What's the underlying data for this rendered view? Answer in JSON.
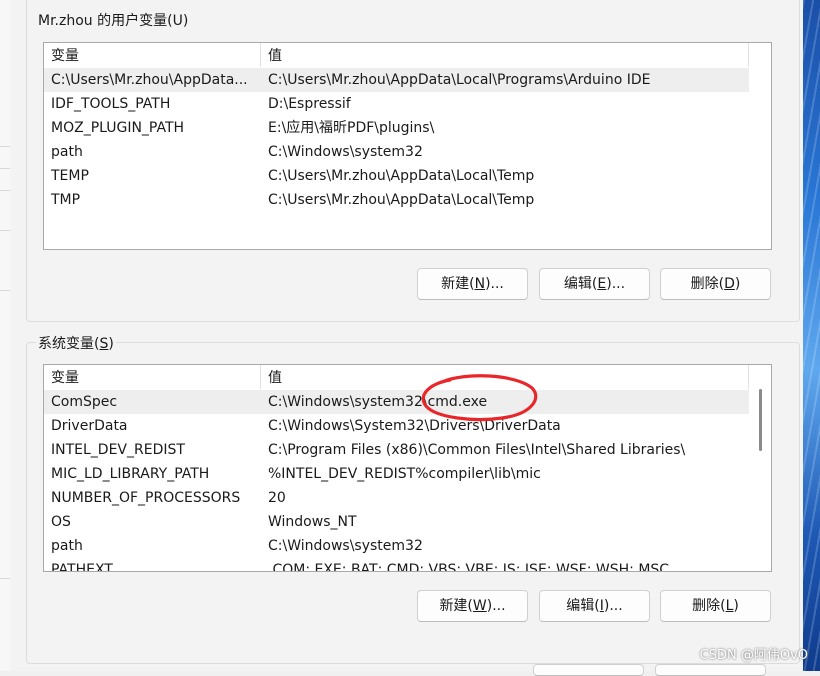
{
  "user_vars": {
    "title": "Mr.zhou 的用户变量(U)",
    "col_name": "变量",
    "col_value": "值",
    "rows": [
      {
        "name": "C:\\Users\\Mr.zhou\\AppData...",
        "value": "C:\\Users\\Mr.zhou\\AppData\\Local\\Programs\\Arduino IDE"
      },
      {
        "name": "IDF_TOOLS_PATH",
        "value": "D:\\Espressif"
      },
      {
        "name": "MOZ_PLUGIN_PATH",
        "value": "E:\\应用\\福昕PDF\\plugins\\"
      },
      {
        "name": "path",
        "value": "C:\\Windows\\system32"
      },
      {
        "name": "TEMP",
        "value": "C:\\Users\\Mr.zhou\\AppData\\Local\\Temp"
      },
      {
        "name": "TMP",
        "value": "C:\\Users\\Mr.zhou\\AppData\\Local\\Temp"
      }
    ],
    "btn_new": "新建(N)...",
    "btn_edit": "编辑(E)...",
    "btn_delete": "删除(D)"
  },
  "system_vars": {
    "title": "系统变量(S)",
    "col_name": "变量",
    "col_value": "值",
    "rows": [
      {
        "name": "ComSpec",
        "value": "C:\\Windows\\system32\\cmd.exe"
      },
      {
        "name": "DriverData",
        "value": "C:\\Windows\\System32\\Drivers\\DriverData"
      },
      {
        "name": "INTEL_DEV_REDIST",
        "value": "C:\\Program Files (x86)\\Common Files\\Intel\\Shared Libraries\\"
      },
      {
        "name": "MIC_LD_LIBRARY_PATH",
        "value": "%INTEL_DEV_REDIST%compiler\\lib\\mic"
      },
      {
        "name": "NUMBER_OF_PROCESSORS",
        "value": "20"
      },
      {
        "name": "OS",
        "value": "Windows_NT"
      },
      {
        "name": "path",
        "value": "C:\\Windows\\system32"
      },
      {
        "name": "PATHEXT",
        "value": ".COM;.EXE;.BAT;.CMD;.VBS;.VBE;.JS;.JSE;.WSF;.WSH;.MSC"
      }
    ],
    "btn_new": "新建(W)...",
    "btn_edit": "编辑(I)...",
    "btn_delete": "删除(L)"
  },
  "watermark": "CSDN @阿伟OvO",
  "colors": {
    "annotation": "#e8272b",
    "selected_row": "#eeeeee",
    "wallpaper": "#2a77d6"
  }
}
